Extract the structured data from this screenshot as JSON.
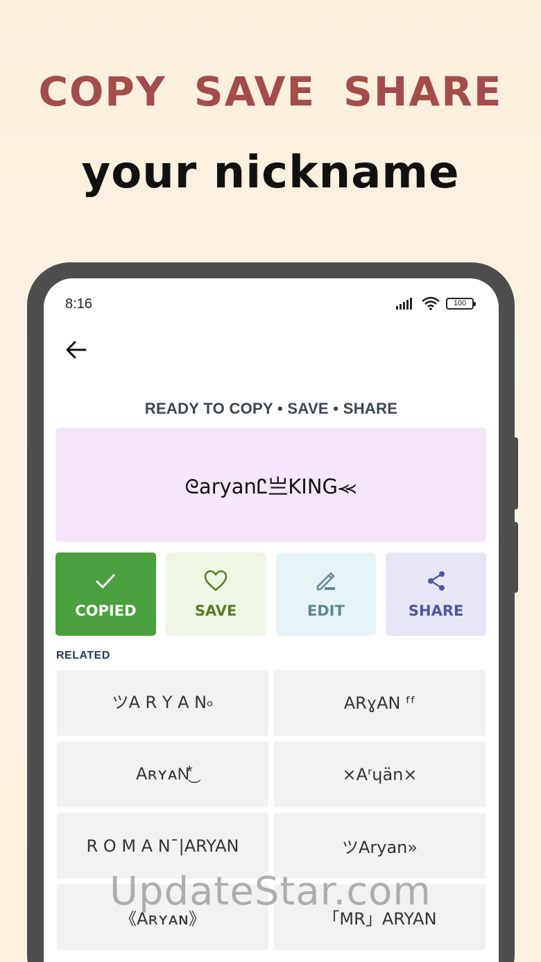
{
  "promo": {
    "headline_words": [
      "COPY",
      "SAVE",
      "SHARE"
    ],
    "subheadline": "your nickname"
  },
  "status_bar": {
    "time": "8:16",
    "battery": "100",
    "icons": [
      "signal-icon",
      "wifi-icon",
      "battery-icon"
    ]
  },
  "nav": {
    "back_icon": "arrow-left-icon"
  },
  "screen": {
    "title": "READY TO COPY • SAVE • SHARE",
    "preview_nickname": "ᘓaryanᏝ亗KING⪻",
    "actions": [
      {
        "label": "COPIED",
        "icon": "check-icon"
      },
      {
        "label": "SAVE",
        "icon": "heart-icon"
      },
      {
        "label": "EDIT",
        "icon": "pencil-icon"
      },
      {
        "label": "SHARE",
        "icon": "share-icon"
      }
    ],
    "related_label": "RELATED",
    "related": [
      "ツA R Y A N৹",
      "ARɣAN ᶠᶠ",
      "AʀʏᴀN⃰͜",
      "×Aʳɥän×",
      "R O M A N¯|ARYAN",
      "ツAryan»",
      "《Aʀʏᴀɴ》",
      "「MR」ARYAN"
    ]
  },
  "colors": {
    "headline": "#a34c4c",
    "copied_bg": "#4aa03e",
    "save_bg": "#eef6e6",
    "edit_bg": "#e7f4f7",
    "share_bg": "#e6e6f7",
    "preview_bg": "#f5e6fb"
  },
  "watermark": "UpdateStar.com"
}
